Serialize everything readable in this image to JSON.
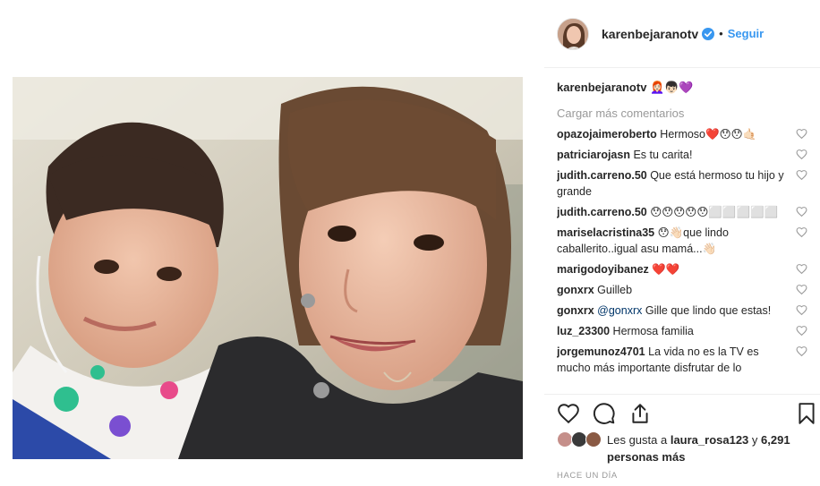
{
  "post": {
    "username": "karenbejaranotv",
    "dot": "•",
    "follow_label": "Seguir",
    "caption_emoji": "👩🏻‍🦰👦🏻💜",
    "load_more": "Cargar más comentarios",
    "comments": [
      {
        "user": "opazojaimeroberto",
        "text": " Hermoso❤️😯😯🤙🏻"
      },
      {
        "user": "patriciarojasn",
        "text": " Es tu carita!"
      },
      {
        "user": "judith.carreno.50",
        "text": " Que está hermoso tu hijo y grande"
      },
      {
        "user": "judith.carreno.50",
        "text": " 😯😯😯😯😯⬜⬜⬜⬜⬜"
      },
      {
        "user": "mariselacristina35",
        "text": " 😯👋🏻que lindo caballerito..igual asu mamá...👋🏻"
      },
      {
        "user": "marigodoyibanez",
        "text": " ❤️❤️"
      },
      {
        "user": "gonxrx",
        "text": " Guilleb"
      },
      {
        "user": "gonxrx",
        "mention": " @gonxrx",
        "text": " Gille que lindo que estas!"
      },
      {
        "user": "luz_23300",
        "text": " Hermosa familia"
      },
      {
        "user": "jorgemunoz4701",
        "text": " La vida no es la TV es mucho más importante disfrutar de lo"
      }
    ],
    "likes_prefix": "Les gusta a ",
    "likes_user": "laura_rosa123",
    "likes_mid": " y ",
    "likes_count": "6,291 personas más",
    "time": "HACE UN DÍA"
  },
  "icons": {
    "verified": "verified-badge-icon",
    "like": "heart-icon",
    "comment": "comment-icon",
    "share": "share-icon",
    "save": "bookmark-icon"
  },
  "colors": {
    "accent": "#3897f0",
    "muted": "#999999",
    "text": "#262626"
  }
}
